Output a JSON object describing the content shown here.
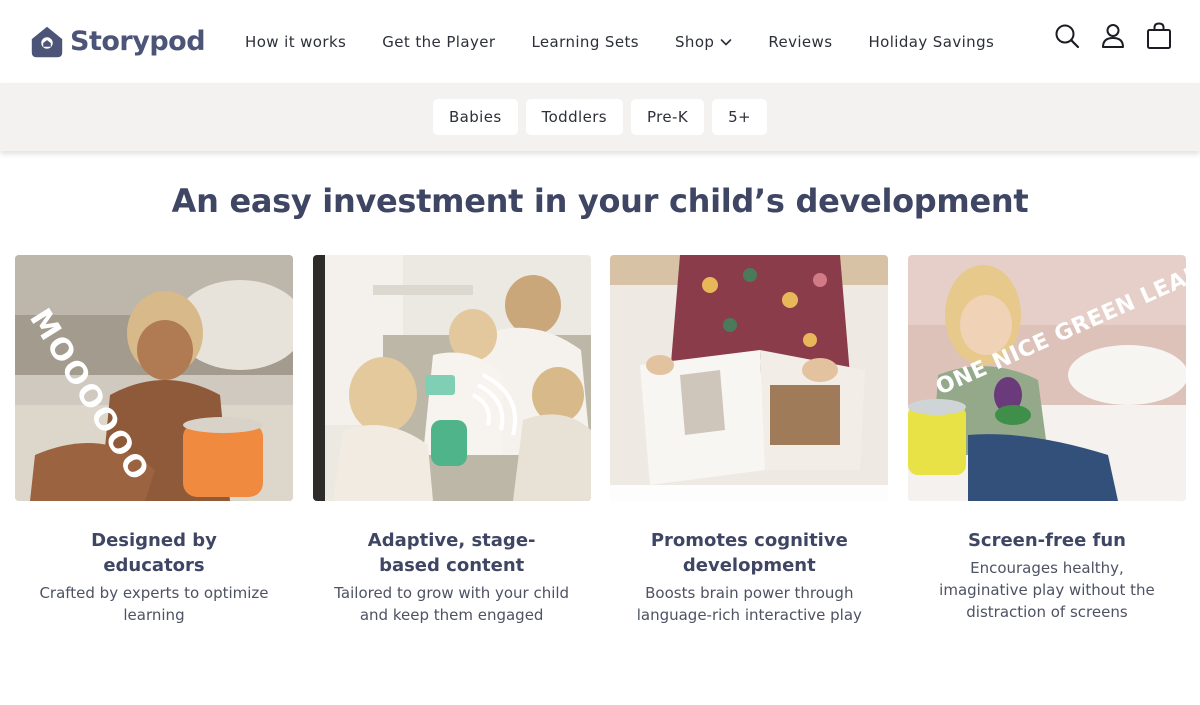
{
  "brand": {
    "name": "Storypod"
  },
  "nav": {
    "items": [
      {
        "label": "How it works"
      },
      {
        "label": "Get the Player"
      },
      {
        "label": "Learning Sets"
      },
      {
        "label": "Shop"
      },
      {
        "label": "Reviews"
      },
      {
        "label": "Holiday Savings"
      }
    ]
  },
  "header_icons": [
    "search-icon",
    "account-icon",
    "shopping-bag-icon"
  ],
  "age_filters": [
    {
      "label": "Babies"
    },
    {
      "label": "Toddlers"
    },
    {
      "label": "Pre-K"
    },
    {
      "label": "5+"
    }
  ],
  "main": {
    "title": "An easy investment in your child’s development",
    "cards": [
      {
        "overlay": "MOOOOOO",
        "title": "Designed by educators",
        "desc": "Crafted by experts to optimize learning"
      },
      {
        "overlay": "",
        "title": "Adaptive, stage-based content",
        "desc": "Tailored to grow with your child and keep them engaged"
      },
      {
        "overlay": "",
        "title": "Promotes cognitive development",
        "desc": "Boosts brain power through language-rich interactive play"
      },
      {
        "overlay": "ONE NICE GREEN LEAF",
        "title": "Screen-free fun",
        "desc": "Encourages healthy, imaginative play without the distraction of screens"
      }
    ]
  },
  "colors": {
    "brand_navy": "#4c5478",
    "heading": "#3f4664",
    "band_bg": "#f3f2f0",
    "player_orange": "#f08a3e",
    "player_yellow": "#e8e246",
    "player_green": "#4fb48a"
  }
}
